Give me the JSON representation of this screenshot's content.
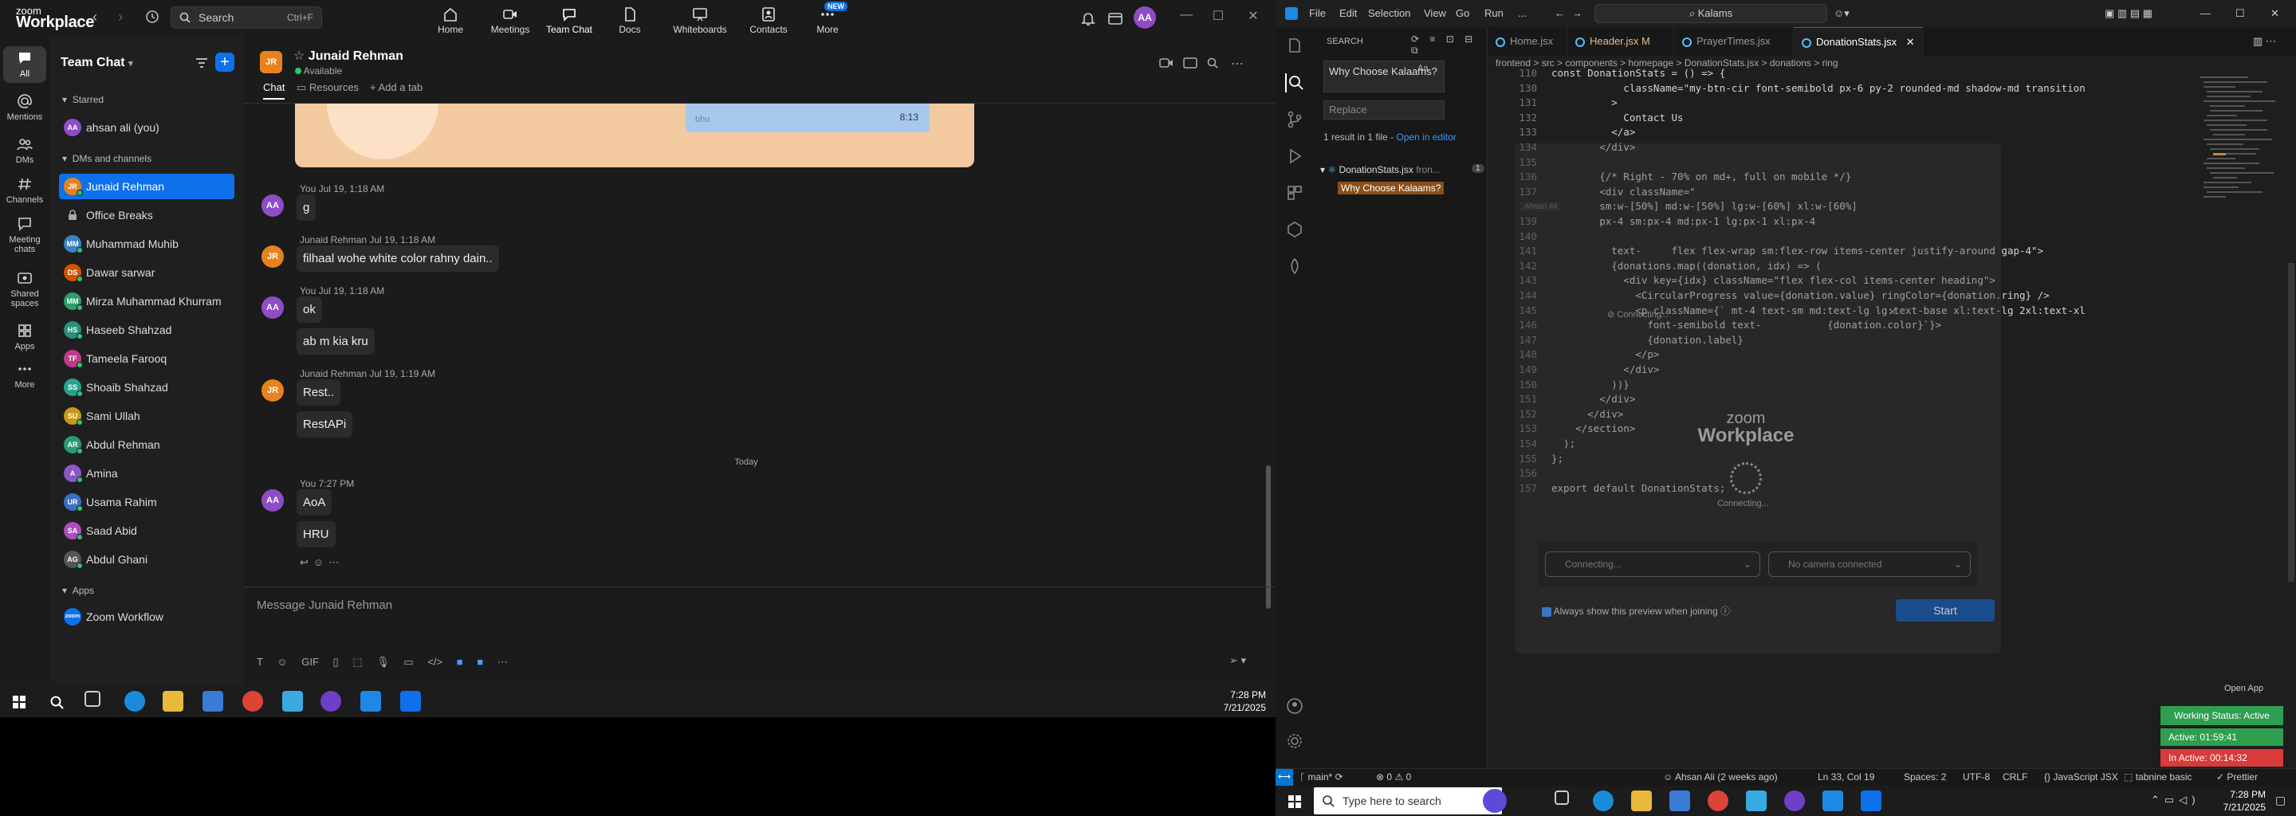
{
  "zoom": {
    "logo_top": "zoom",
    "logo_bottom": "Workplace",
    "search_label": "Search",
    "search_shortcut": "Ctrl+F",
    "tabs": [
      {
        "label": "Home",
        "icon": "home-icon"
      },
      {
        "label": "Meetings",
        "icon": "video-icon"
      },
      {
        "label": "Team Chat",
        "icon": "chat-icon"
      },
      {
        "label": "Docs",
        "icon": "doc-icon"
      },
      {
        "label": "Whiteboards",
        "icon": "whiteboard-icon"
      },
      {
        "label": "Contacts",
        "icon": "contacts-icon"
      },
      {
        "label": "More",
        "icon": "more-icon"
      }
    ],
    "new_badge": "NEW",
    "avatar": "AA",
    "rail": [
      {
        "label": "All"
      },
      {
        "label": "Mentions"
      },
      {
        "label": "DMs"
      },
      {
        "label": "Channels"
      },
      {
        "label": "Meeting chats"
      },
      {
        "label": "Shared spaces"
      },
      {
        "label": "Apps"
      },
      {
        "label": "More"
      }
    ],
    "side_title": "Team Chat",
    "starred_label": "Starred",
    "starred": [
      {
        "name": "ahsan ali (you)",
        "initials": "AA",
        "color": "#8f4cc7"
      }
    ],
    "dms_label": "DMs and channels",
    "contacts": [
      {
        "name": "Junaid Rehman",
        "initials": "JR",
        "color": "#e8821e"
      },
      {
        "name": "Office Breaks",
        "initials": "",
        "color": ""
      },
      {
        "name": "Muhammad Muhib",
        "initials": "MM",
        "color": "#3b82c4"
      },
      {
        "name": "Dawar sarwar",
        "initials": "DS",
        "color": "#d35400"
      },
      {
        "name": "Mirza Muhammad Khurram",
        "initials": "MM",
        "color": "#2e9e6a"
      },
      {
        "name": "Haseeb Shahzad",
        "initials": "HS",
        "color": "#2a8f7c"
      },
      {
        "name": "Tameela Farooq",
        "initials": "TF",
        "color": "#c0398c"
      },
      {
        "name": "Shoaib Shahzad",
        "initials": "SS",
        "color": "#2aa18c"
      },
      {
        "name": "Sami Ullah",
        "initials": "SU",
        "color": "#c89a16"
      },
      {
        "name": "Abdul Rehman",
        "initials": "AR",
        "color": "#2a9a72"
      },
      {
        "name": "Amina",
        "initials": "A",
        "color": "#8a56c9"
      },
      {
        "name": "Usama Rahim",
        "initials": "UR",
        "color": "#3b6fc4"
      },
      {
        "name": "Saad Abid",
        "initials": "SA",
        "color": "#b04cc0"
      },
      {
        "name": "Abdul Ghani",
        "initials": "AG",
        "color": "#555"
      }
    ],
    "apps_label": "Apps",
    "apps": [
      {
        "name": "Zoom Workflow"
      }
    ],
    "chat": {
      "contact_name": "Junaid Rehman",
      "contact_status": "Available",
      "tab_chat": "Chat",
      "tab_resources": "Resources",
      "tab_add": "Add a tab",
      "image_caption": "bhu",
      "image_time": "8:13",
      "messages": [
        {
          "meta": "You Jul 19, 1:18 AM",
          "initials": "AA",
          "color": "#8f4cc7",
          "text": [
            "g"
          ]
        },
        {
          "meta": "Junaid Rehman Jul 19, 1:18 AM",
          "initials": "JR",
          "color": "#e8821e",
          "text": [
            "filhaal wohe white color rahny dain.."
          ]
        },
        {
          "meta": "You Jul 19, 1:18 AM",
          "initials": "AA",
          "color": "#8f4cc7",
          "text": [
            "ok",
            "ab m kia kru"
          ]
        },
        {
          "meta": "Junaid Rehman Jul 19, 1:19 AM",
          "initials": "JR",
          "color": "#e8821e",
          "text": [
            "Rest..",
            "RestAPi"
          ]
        },
        {
          "meta": "You 7:27 PM",
          "initials": "AA",
          "color": "#8f4cc7",
          "text": [
            "AoA",
            "HRU"
          ]
        }
      ],
      "today": "Today",
      "compose_placeholder": "Message Junaid Rehman"
    }
  },
  "taskbar_left": {
    "time": "7:28 PM",
    "date": "7/21/2025"
  },
  "vscode": {
    "menu": [
      "File",
      "Edit",
      "Selection",
      "View",
      "Go",
      "Run",
      "..."
    ],
    "search_box": "Kalams",
    "search_panel": {
      "title": "SEARCH",
      "query": "Why Choose Kalaams?",
      "replace_placeholder": "Replace",
      "result_text": "1 result in 1 file - ",
      "open_in_editor": "Open in editor",
      "file": "DonationStats.jsx",
      "file_path": "fron...",
      "match": "Why Choose Kalaams?",
      "count": "1"
    },
    "tabs": [
      {
        "label": "Home.jsx"
      },
      {
        "label": "Header.jsx M"
      },
      {
        "label": "PrayerTimes.jsx"
      },
      {
        "label": "DonationStats.jsx"
      }
    ],
    "breadcrumb": "frontend  >  src  >  components  >  homepage  >  DonationStats.jsx  >  donations  >  ring",
    "code": [
      {
        "n": "110",
        "t": "const DonationStats = () => {"
      },
      {
        "n": "130",
        "t": "            className=\"my-btn-cir font-semibold px-6 py-2 rounded-md shadow-md transition"
      },
      {
        "n": "131",
        "t": "          >"
      },
      {
        "n": "132",
        "t": "            Contact Us"
      },
      {
        "n": "133",
        "t": "          </a>"
      },
      {
        "n": "134",
        "t": "        </div>"
      },
      {
        "n": "135",
        "t": ""
      },
      {
        "n": "136",
        "t": "        {/* Right - 70% on md+, full on mobile */}"
      },
      {
        "n": "137",
        "t": "        <div className=\""
      },
      {
        "n": "138",
        "t": "        sm:w-[50%] md:w-[50%] lg:w-[60%] xl:w-[60%]"
      },
      {
        "n": "139",
        "t": "        px-4 sm:px-4 md:px-1 lg:px-1 xl:px-4"
      },
      {
        "n": "140",
        "t": ""
      },
      {
        "n": "141",
        "t": "          text-     flex flex-wrap sm:flex-row items-center justify-around gap-4\">"
      },
      {
        "n": "142",
        "t": "          {donations.map((donation, idx) => ("
      },
      {
        "n": "143",
        "t": "            <div key={idx} className=\"flex flex-col items-center heading\">"
      },
      {
        "n": "144",
        "t": "              <CircularProgress value={donation.value} ringColor={donation.ring} />"
      },
      {
        "n": "145",
        "t": "              <p className={` mt-4 text-sm md:text-lg lg:text-base xl:text-lg 2xl:text-xl"
      },
      {
        "n": "146",
        "t": "                font-semibold text-           {donation.color}`}>"
      },
      {
        "n": "147",
        "t": "                {donation.label}"
      },
      {
        "n": "148",
        "t": "              </p>"
      },
      {
        "n": "149",
        "t": "            </div>"
      },
      {
        "n": "150",
        "t": "          ))}"
      },
      {
        "n": "151",
        "t": "        </div>"
      },
      {
        "n": "152",
        "t": "      </div>"
      },
      {
        "n": "153",
        "t": "    </section>"
      },
      {
        "n": "154",
        "t": "  );"
      },
      {
        "n": "155",
        "t": "};"
      },
      {
        "n": "156",
        "t": ""
      },
      {
        "n": "157",
        "t": "export default DonationStats;"
      }
    ],
    "inline_author": "Ahsan Ali",
    "status": {
      "branch": "main*",
      "errors": "0",
      "warnings": "0",
      "blame": "Ahsan Ali (2 weeks ago)",
      "position": "Ln 33, Col 19",
      "spaces": "Spaces: 2",
      "encoding": "UTF-8",
      "eol": "CRLF",
      "language": "JavaScript JSX",
      "tabnine": "tabnine basic",
      "prettier": "Prettier"
    }
  },
  "zoom_preview": {
    "connecting": "Connecting...",
    "title_top": "zoom",
    "title_bottom": "Workplace",
    "status": "Connecting...",
    "mic": "Connecting...",
    "camera": "No camera connected",
    "checkbox_label": "Always show this preview when joining",
    "start": "Start"
  },
  "widget": {
    "open_app": "Open App",
    "working_status": "Working Status: Active",
    "active": "Active: 01:59:41",
    "inactive": "In Active: 00:14:32",
    "active_color": "#2e9e4f",
    "inactive_color": "#d93a3a"
  },
  "taskbar_right": {
    "search": "Type here to search",
    "time": "7:28 PM",
    "date": "7/21/2025"
  }
}
